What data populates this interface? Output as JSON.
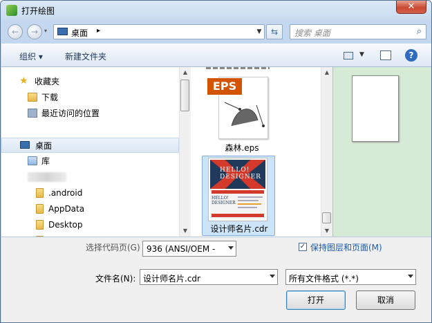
{
  "window": {
    "title": "打开绘图",
    "close_label": "✕"
  },
  "nav": {
    "back_icon": "←",
    "forward_icon": "→",
    "address": "桌面",
    "address_arrow": "▸",
    "search_placeholder": "搜索 桌面"
  },
  "toolbar": {
    "organize": "组织 ▾",
    "new_folder": "新建文件夹"
  },
  "sidebar": {
    "favorites": "收藏夹",
    "downloads": "下载",
    "recent": "最近访问的位置",
    "desktop": "桌面",
    "library": "库",
    "items": [
      ".android",
      "AppData",
      "Desktop"
    ]
  },
  "files": [
    {
      "name": "森林.eps",
      "badge": "EPS"
    },
    {
      "name": "设计师名片.cdr",
      "thumb_text1": "HELLO!",
      "thumb_text2": "DESIGNER"
    }
  ],
  "bottom": {
    "codepage_label": "选择代码页(G)",
    "codepage_value": "936 (ANSI/OEM -",
    "keep_layers_label": "保持图层和页面(M)",
    "filename_label": "文件名(N):",
    "filename_value": "设计师名片.cdr",
    "filetype_value": "所有文件格式 (*.*)",
    "open_button": "打开",
    "cancel_button": "取消"
  },
  "colors": {
    "accent": "#3a6fb0",
    "selection": "#cce4f7",
    "preview_bg": "#d5ebd5",
    "eps_badge": "#d35400"
  }
}
